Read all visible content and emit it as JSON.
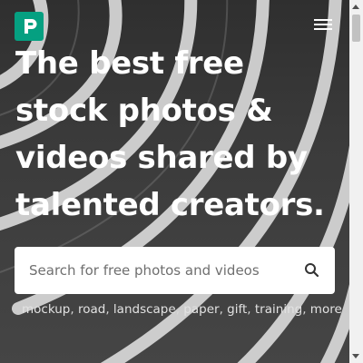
{
  "header": {
    "logo_icon": "pexels-logo-icon",
    "menu_icon": "hamburger-menu-icon",
    "brand_color": "#05a081"
  },
  "hero": {
    "headline": "The best free stock photos & videos shared by talented creators.",
    "background": "black-and-white road with curved lane lines"
  },
  "search": {
    "placeholder": "Search for free photos and videos",
    "value": "",
    "icon": "search-icon"
  },
  "tags": {
    "items": [
      "mockup",
      "road",
      "landscape",
      "paper",
      "gift",
      "training"
    ],
    "more_label": "more",
    "separator": ","
  }
}
